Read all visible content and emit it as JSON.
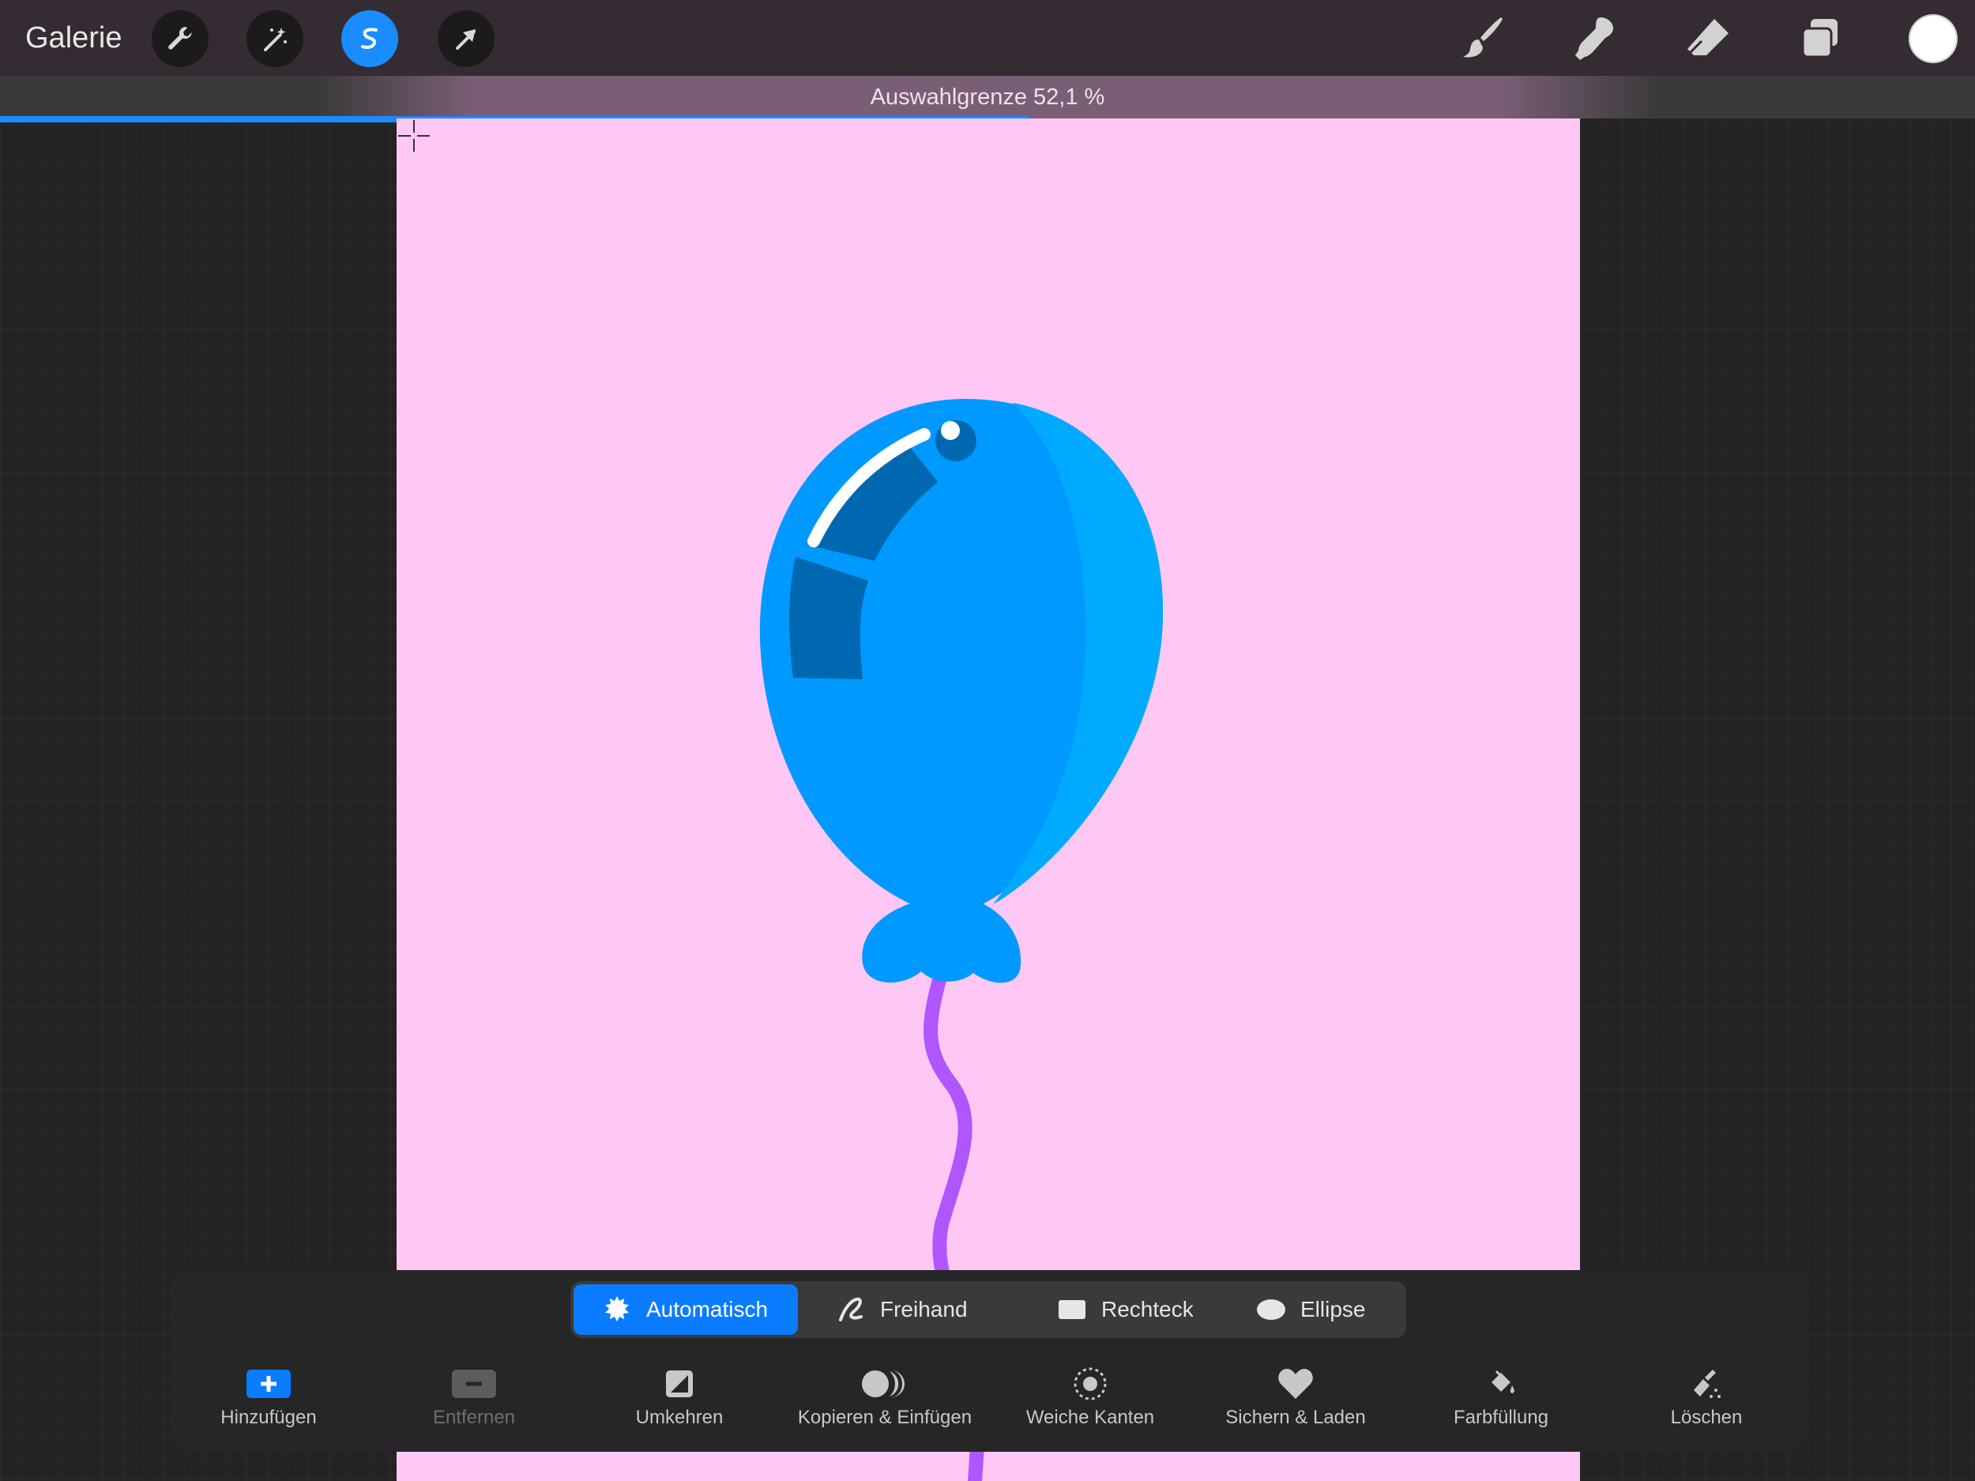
{
  "topbar": {
    "gallery_label": "Galerie",
    "left_tools": [
      "wrench-icon",
      "magic-wand-icon",
      "selection-icon",
      "transform-arrow-icon"
    ],
    "active_tool": "selection-icon",
    "right_tools": [
      "brush-icon",
      "smudge-icon",
      "eraser-icon",
      "layers-icon"
    ],
    "current_color": "#ffffff"
  },
  "threshold": {
    "label": "Auswahlgrenze 52,1 %",
    "value_percent": 52.1
  },
  "canvas": {
    "background_color": "#ffc8f4",
    "balloon_color": "#0099ff",
    "string_color": "#b155ff"
  },
  "selection_modes": [
    {
      "label": "Automatisch",
      "icon": "automatic-icon",
      "active": true
    },
    {
      "label": "Freihand",
      "icon": "freehand-icon",
      "active": false
    },
    {
      "label": "Rechteck",
      "icon": "rectangle-icon",
      "active": false
    },
    {
      "label": "Ellipse",
      "icon": "ellipse-icon",
      "active": false
    }
  ],
  "actions": [
    {
      "label": "Hinzufügen",
      "icon": "add-icon",
      "enabled": true
    },
    {
      "label": "Entfernen",
      "icon": "remove-icon",
      "enabled": false
    },
    {
      "label": "Umkehren",
      "icon": "invert-icon",
      "enabled": true
    },
    {
      "label": "Kopieren & Einfügen",
      "icon": "copy-paste-icon",
      "enabled": true
    },
    {
      "label": "Weiche Kanten",
      "icon": "feather-icon",
      "enabled": true
    },
    {
      "label": "Sichern & Laden",
      "icon": "heart-icon",
      "enabled": true
    },
    {
      "label": "Farbfüllung",
      "icon": "color-fill-icon",
      "enabled": true
    },
    {
      "label": "Löschen",
      "icon": "clear-icon",
      "enabled": true
    }
  ]
}
